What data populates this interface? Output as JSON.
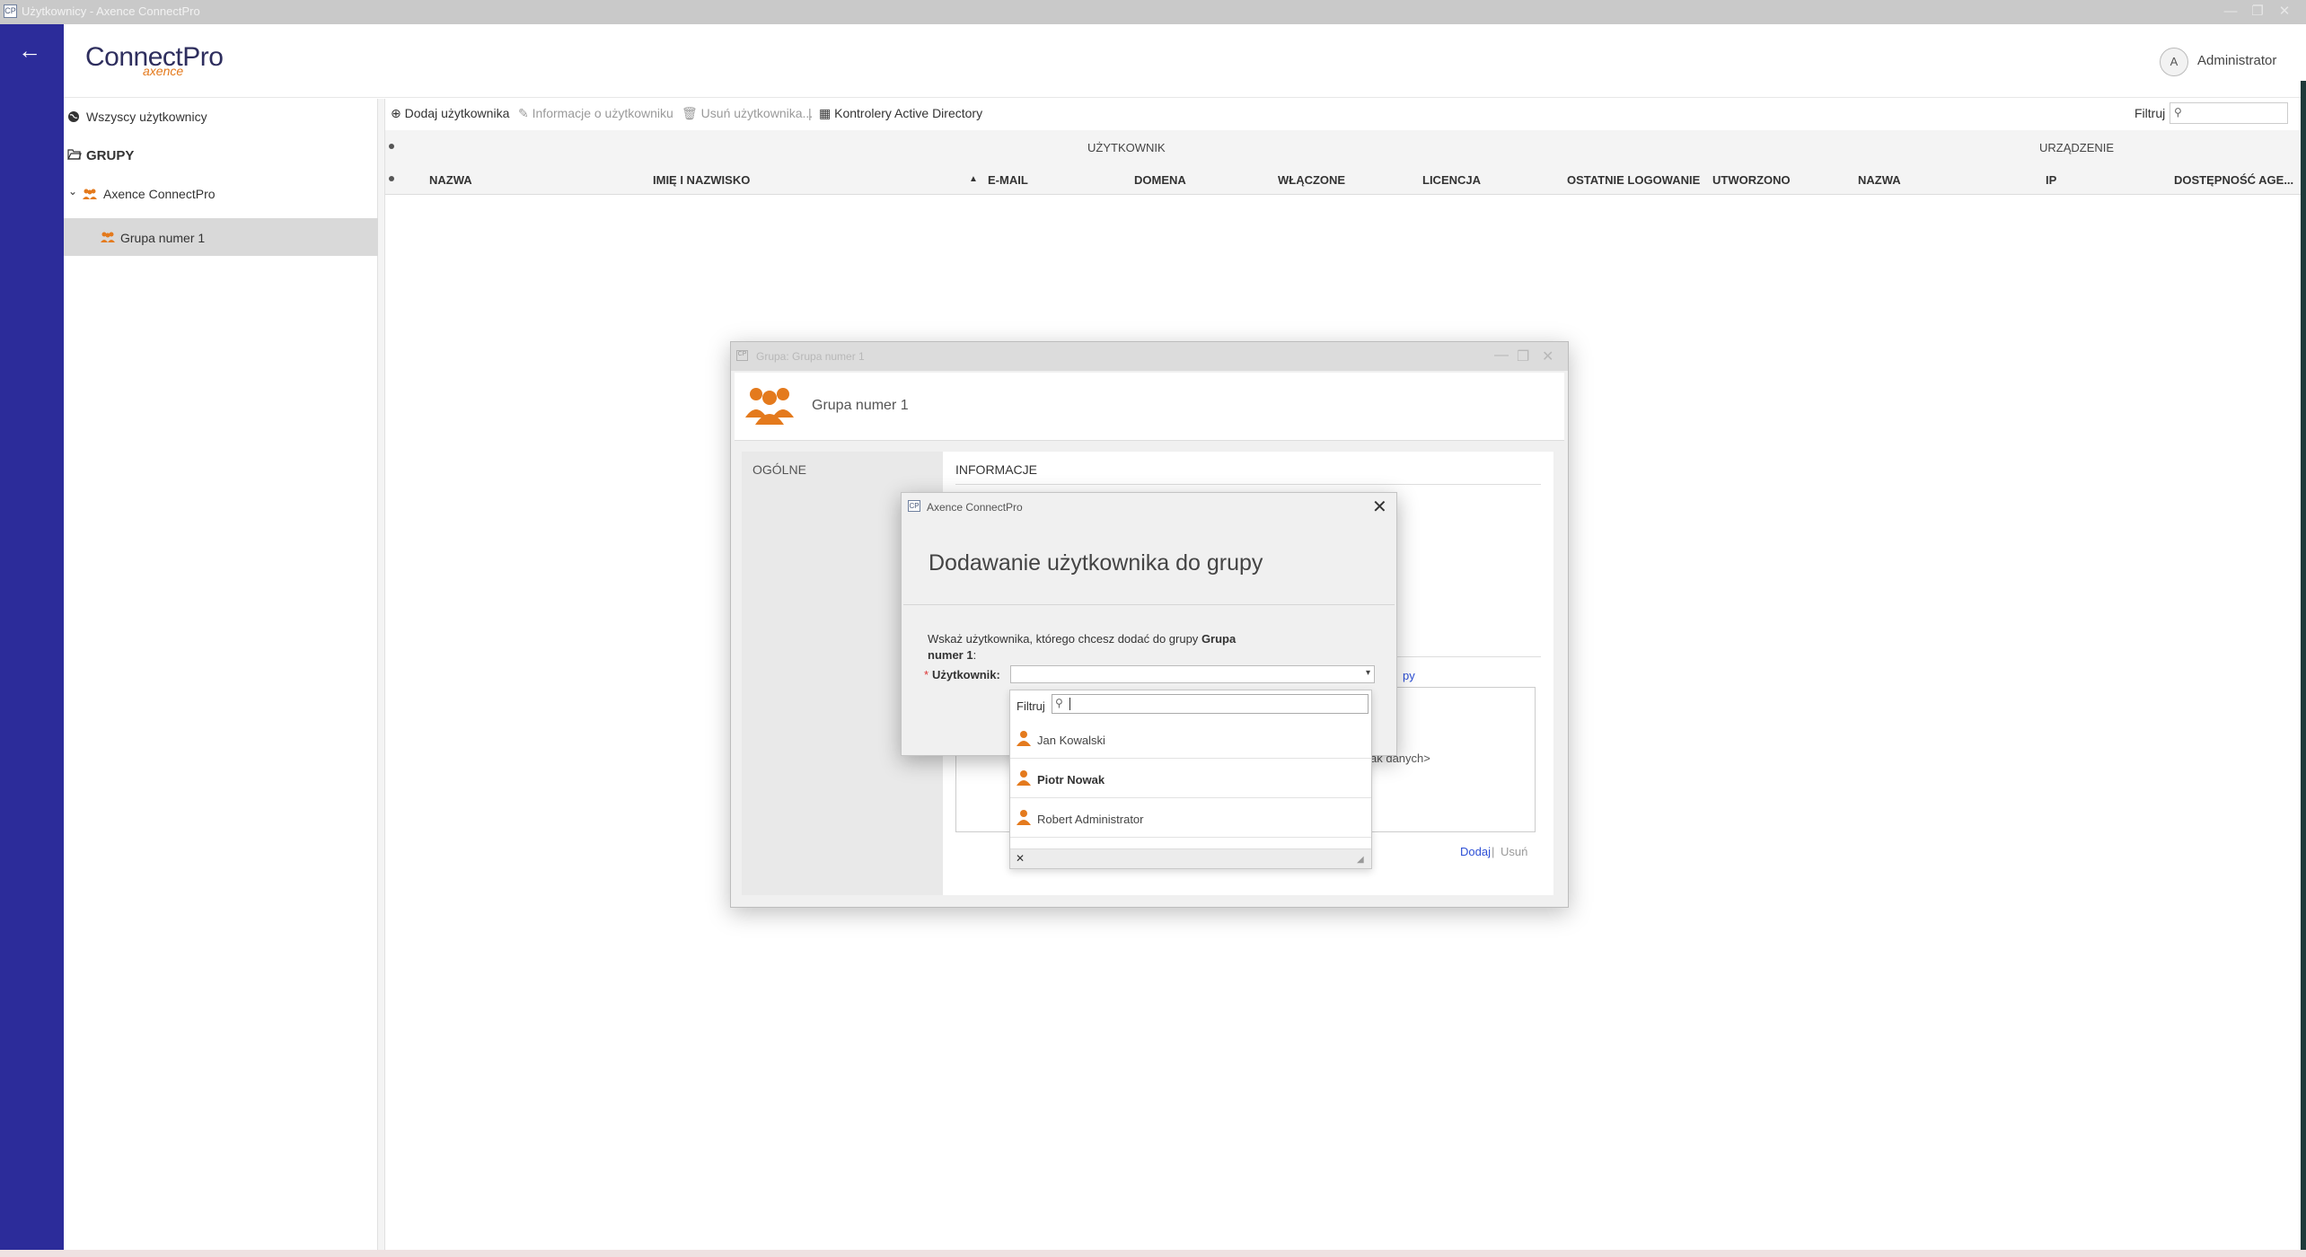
{
  "window": {
    "title": "Użytkownicy - Axence ConnectPro",
    "app_icon": "CP",
    "controls": [
      "—",
      "❐",
      "✕"
    ]
  },
  "header": {
    "logo_main": "ConnectPro",
    "logo_sub": "axence",
    "avatar_letter": "A",
    "user": "Administrator"
  },
  "sidebar": {
    "all_users": "Wszyscy użytkownicy",
    "groups_title": "GRUPY",
    "tree_root": "Axence ConnectPro",
    "tree_child": "Grupa numer 1"
  },
  "toolbar": {
    "add_user": "Dodaj użytkownika",
    "user_info": "Informacje o użytkowniku",
    "remove_user": "Usuń użytkownika...",
    "ad_controllers": "Kontrolery Active Directory",
    "filter_label": "Filtruj"
  },
  "table": {
    "group_user": "UŻYTKOWNIK",
    "group_device": "URZĄDZENIE",
    "columns": [
      "NAZWA",
      "IMIĘ I NAZWISKO",
      "E-MAIL",
      "DOMENA",
      "WŁĄCZONE",
      "LICENCJA",
      "OSTATNIE LOGOWANIE",
      "UTWORZONO",
      "NAZWA",
      "IP",
      "DOSTĘPNOŚĆ AGE..."
    ]
  },
  "group_window": {
    "title": "Grupa: Grupa numer 1",
    "group_name": "Grupa numer 1",
    "tab_general": "OGÓLNE",
    "section_info": "INFORMACJE",
    "link_partial": "py",
    "no_data_partial": "ak danych>",
    "add": "Dodaj",
    "separator": "|",
    "remove": "Usuń"
  },
  "dialog": {
    "title": "Axence ConnectPro",
    "app_icon": "CP",
    "heading": "Dodawanie użytkownika do grupy",
    "instruction": "Wskaż użytkownika, którego chcesz dodać do grupy",
    "instruction_group": "Grupa numer 1",
    "instruction_end": ":",
    "required_mark": "*",
    "user_label": "Użytkownik:"
  },
  "dropdown": {
    "filter_label": "Filtruj",
    "filter_value": "",
    "items": [
      {
        "label": "Jan Kowalski",
        "bold": false
      },
      {
        "label": "Piotr Nowak",
        "bold": true
      },
      {
        "label": "Robert Administrator",
        "bold": false
      }
    ],
    "clear": "✕",
    "grip": "◢"
  },
  "colors": {
    "rail": "#2c2c9a",
    "accent_orange": "#e47a1d",
    "link_blue": "#2c4fd6"
  }
}
